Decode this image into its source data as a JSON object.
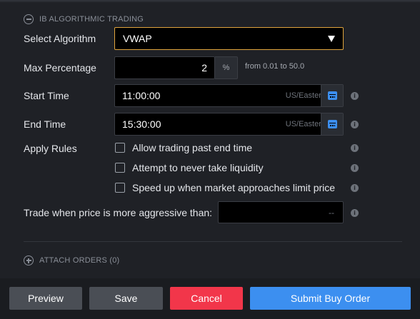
{
  "section": {
    "title": "IB ALGORITHMIC TRADING"
  },
  "algorithm": {
    "label": "Select Algorithm",
    "value": "VWAP"
  },
  "max_percentage": {
    "label": "Max Percentage",
    "value": "2",
    "unit": "%",
    "hint": "from 0.01 to 50.0"
  },
  "start_time": {
    "label": "Start Time",
    "value": "11:00:00",
    "timezone": "US/Eastern"
  },
  "end_time": {
    "label": "End Time",
    "value": "15:30:00",
    "timezone": "US/Eastern"
  },
  "apply_rules": {
    "label": "Apply Rules",
    "options": [
      {
        "label": "Allow trading past end time",
        "checked": false
      },
      {
        "label": "Attempt to never take liquidity",
        "checked": false
      },
      {
        "label": "Speed up when market approaches limit price",
        "checked": false
      }
    ]
  },
  "aggressive": {
    "label": "Trade when price is more aggressive than:",
    "value": "--"
  },
  "attach_orders": {
    "title": "ATTACH ORDERS (0)"
  },
  "footer": {
    "preview": "Preview",
    "save": "Save",
    "cancel": "Cancel",
    "submit": "Submit Buy Order"
  },
  "colors": {
    "accent_blue": "#3c8ff0",
    "cancel_red": "#f2364a",
    "select_border": "#e0a43c"
  }
}
